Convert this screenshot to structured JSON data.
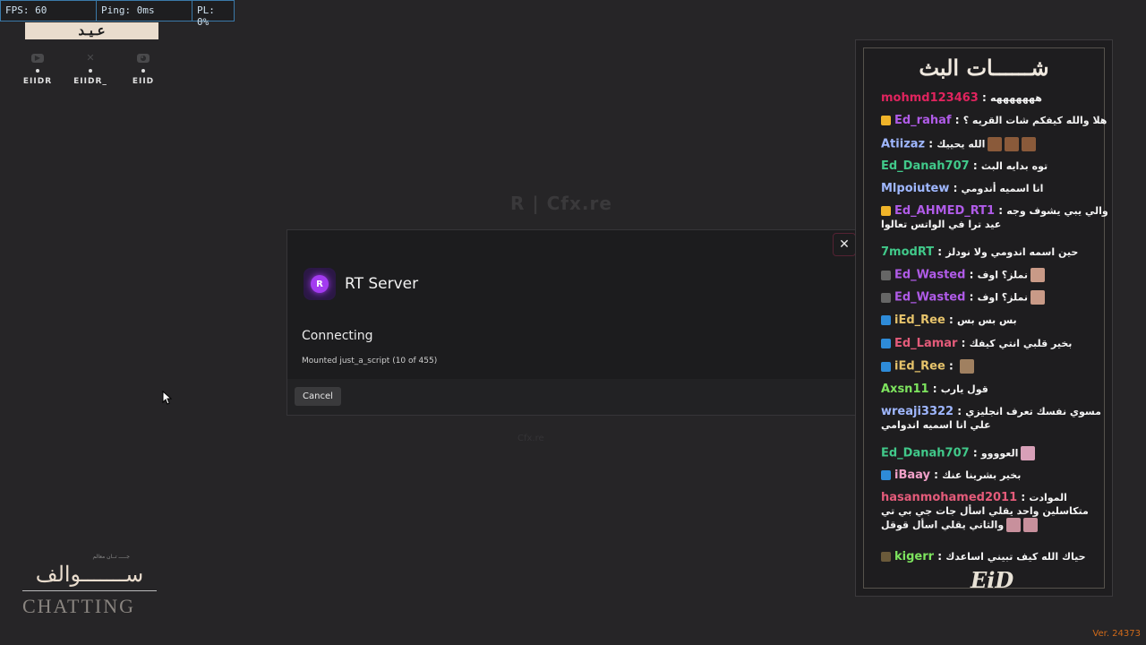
{
  "perf": {
    "fps": "FPS: 60",
    "ping": "Ping: 0ms",
    "pl": "PL: 0%"
  },
  "overlay": {
    "logo_text": "عـيـد",
    "socials": [
      {
        "icon": "youtube-icon",
        "label": "EIIDR"
      },
      {
        "icon": "x-icon",
        "label": "EIIDR_"
      },
      {
        "icon": "discord-icon",
        "label": "EIID"
      }
    ],
    "brand": {
      "tagline": "جـــــ تــان معالم",
      "arabic": "ســـــــوالف",
      "english": "CHATTING"
    }
  },
  "background": {
    "brand": "R | Cfx.re",
    "sub": "Cfx.re"
  },
  "modal": {
    "close_label": "✕",
    "server_name": "RT Server",
    "status": "Connecting",
    "detail": "Mounted just_a_script (10 of 455)",
    "cancel_label": "Cancel"
  },
  "chat": {
    "title": "شــــــات البث",
    "messages": [
      {
        "user": "mohmd123463",
        "text": "هههههههه",
        "color": "#e0245e"
      },
      {
        "user": "Ed_rahaf",
        "text": "هلا والله كيفكم شات القريه ؟",
        "color": "#b05be8",
        "badge": "#f0b429"
      },
      {
        "user": "Atiizaz",
        "text": "الله يحييك",
        "color": "#9fb7ff",
        "emotes": [
          "#8a5a3a",
          "#8a5a3a",
          "#8a5a3a"
        ]
      },
      {
        "user": "Ed_Danah707",
        "text": "توه بدايه البث",
        "color": "#41c98a"
      },
      {
        "user": "Mlpoiutew",
        "text": "انا اسميه أندومي",
        "color": "#9fb7ff"
      },
      {
        "user": "Ed_AHMED_RT1",
        "text": "والي يبي يشوف وجه عيد ترا في الواتس تعالوا",
        "color": "#b05be8",
        "badge": "#f0b429"
      },
      {
        "user": "7modRT",
        "text": "حين اسمه اندومي ولا نودلز",
        "color": "#41c98a"
      },
      {
        "user": "Ed_Wasted",
        "text": "نملز؟ اوف",
        "color": "#b05be8",
        "badge": "#666666",
        "emotes": [
          "#c99a87"
        ]
      },
      {
        "user": "Ed_Wasted",
        "text": "نملز؟ اوف",
        "color": "#b05be8",
        "badge": "#666666",
        "emotes": [
          "#c99a87"
        ]
      },
      {
        "user": "iEd_Ree",
        "text": "بس بس بس",
        "color": "#e6c36b",
        "badge": "#2e8bd8"
      },
      {
        "user": "Ed_Lamar",
        "text": "بخير قلبي انتي كيفك",
        "color": "#e45b7a",
        "badge": "#2e8bd8"
      },
      {
        "user": "iEd_Ree",
        "text": "",
        "color": "#e6c36b",
        "badge": "#2e8bd8",
        "emotes": [
          "#a08060"
        ]
      },
      {
        "user": "Axsn11",
        "text": "قول يارب",
        "color": "#7de35e"
      },
      {
        "user": "wreaji3322",
        "text": "مسوي نفسك تعرف انجليزي علي انا اسميه اندوامي",
        "color": "#9fb7ff"
      },
      {
        "user": "Ed_Danah707",
        "text": "العوووو",
        "color": "#41c98a",
        "emotes": [
          "#d8a0b8"
        ]
      },
      {
        "user": "iBaay",
        "text": "بخير بشرينا عنك",
        "color": "#f0a0c8",
        "badge": "#2e8bd8"
      },
      {
        "user": "hasanmohamed2011",
        "text": "الموادت متكاسلين واحد يقلي اسأل جات جي بي تي والثاني يقلي اسأل قوقل",
        "color": "#e45b7a",
        "emotes": [
          "#c8909c",
          "#c8909c"
        ]
      },
      {
        "user": "kigerr",
        "text": "حياك الله كيف تبيني اساعدك",
        "color": "#7de35e",
        "badge": "#6b5a3a"
      }
    ],
    "logo": "EiD"
  },
  "version": "Ver. 24373"
}
